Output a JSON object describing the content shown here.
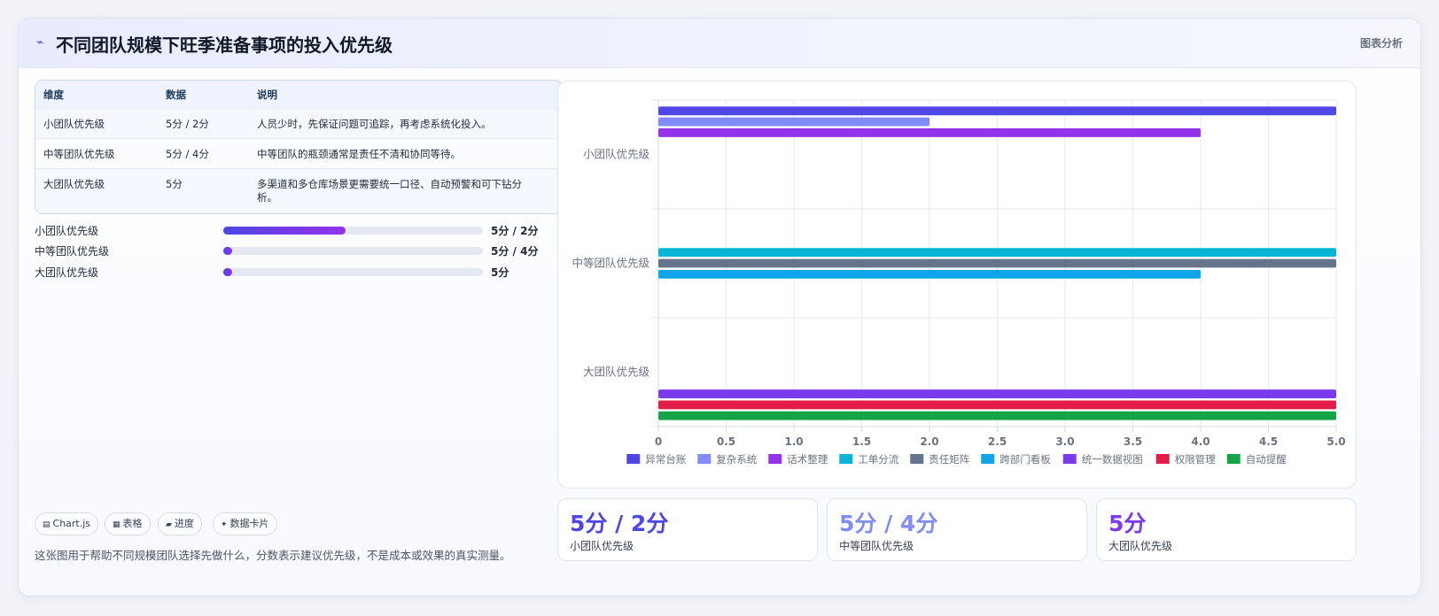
{
  "header": {
    "icon": "trend-icon",
    "title": "不同团队规模下旺季准备事项的投入优先级",
    "right_label": "图表分析"
  },
  "table": {
    "columns": [
      "维度",
      "数据",
      "说明"
    ],
    "rows": [
      {
        "dimension": "小团队优先级",
        "value": "5分 / 2分",
        "note": "人员少时，先保证问题可追踪，再考虑系统化投入。"
      },
      {
        "dimension": "中等团队优先级",
        "value": "5分 / 4分",
        "note": "中等团队的瓶颈通常是责任不清和协同等待。"
      },
      {
        "dimension": "大团队优先级",
        "value": "5分",
        "note": "多渠道和多仓库场景更需要统一口径、自动预警和可下钻分析。"
      }
    ]
  },
  "progress": [
    {
      "label": "小团队优先级",
      "value": "5分 / 2分",
      "fraction": 0.47
    },
    {
      "label": "中等团队优先级",
      "value": "5分 / 4分",
      "fraction": 0.03
    },
    {
      "label": "大团队优先级",
      "value": "5分",
      "fraction": 0.03
    }
  ],
  "chips": [
    {
      "icon": "chart-icon",
      "glyph": "▤",
      "label": "Chart.js"
    },
    {
      "icon": "table-icon",
      "glyph": "▦",
      "label": "表格"
    },
    {
      "icon": "progress-icon",
      "glyph": "▰",
      "label": "进度"
    },
    {
      "icon": "sparkle-icon",
      "glyph": "✦",
      "label": "数据卡片"
    }
  ],
  "footnote": "这张图用于帮助不同规模团队选择先做什么，分数表示建议优先级，不是成本或效果的真实测量。",
  "stats": [
    {
      "value": "5分 / 2分",
      "label": "小团队优先级",
      "color": "#4f46e5"
    },
    {
      "value": "5分 / 4分",
      "label": "中等团队优先级",
      "color": "#818cf8"
    },
    {
      "value": "5分",
      "label": "大团队优先级",
      "color": "#7c3aed"
    }
  ],
  "chart_data": {
    "type": "bar",
    "orientation": "horizontal",
    "categories": [
      "小团队优先级",
      "中等团队优先级",
      "大团队优先级"
    ],
    "xlim": [
      0,
      5
    ],
    "xticks": [
      "0",
      "0.5",
      "1.0",
      "1.5",
      "2.0",
      "2.5",
      "3.0",
      "3.5",
      "4.0",
      "4.5",
      "5.0"
    ],
    "grid": true,
    "legend_position": "bottom",
    "series": [
      {
        "name": "异常台账",
        "color": "#4f46e5",
        "values": [
          5,
          null,
          null
        ]
      },
      {
        "name": "复杂系统",
        "color": "#818cf8",
        "values": [
          2,
          null,
          null
        ]
      },
      {
        "name": "话术整理",
        "color": "#9333ea",
        "values": [
          4,
          null,
          null
        ]
      },
      {
        "name": "工单分流",
        "color": "#06b6d4",
        "values": [
          null,
          5,
          null
        ]
      },
      {
        "name": "责任矩阵",
        "color": "#64748b",
        "values": [
          null,
          5,
          null
        ]
      },
      {
        "name": "跨部门看板",
        "color": "#0ea5e9",
        "values": [
          null,
          4,
          null
        ]
      },
      {
        "name": "统一数据视图",
        "color": "#7c3aed",
        "values": [
          null,
          null,
          5
        ]
      },
      {
        "name": "权限管理",
        "color": "#e11d48",
        "values": [
          null,
          null,
          5
        ]
      },
      {
        "name": "自动提醒",
        "color": "#16a34a",
        "values": [
          null,
          null,
          5
        ]
      }
    ]
  }
}
